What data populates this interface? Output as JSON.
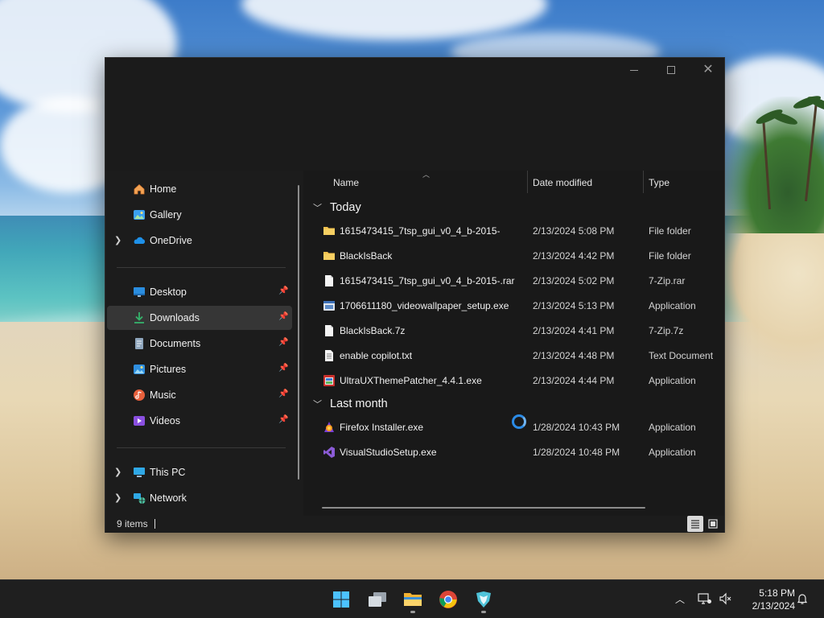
{
  "window": {
    "controls": {
      "minimize": "minimize",
      "maximize": "maximize",
      "close": "close"
    }
  },
  "nav": {
    "items": [
      {
        "label": "Home",
        "icon": "home-icon",
        "expandable": false,
        "pinned": false
      },
      {
        "label": "Gallery",
        "icon": "gallery-icon",
        "expandable": false,
        "pinned": false
      },
      {
        "label": "OneDrive",
        "icon": "onedrive-cloud-icon",
        "expandable": true,
        "pinned": false
      },
      {
        "label": "Desktop",
        "icon": "desktop-icon",
        "expandable": false,
        "pinned": true
      },
      {
        "label": "Downloads",
        "icon": "download-arrow-icon",
        "expandable": false,
        "pinned": true,
        "selected": true
      },
      {
        "label": "Documents",
        "icon": "document-icon",
        "expandable": false,
        "pinned": true
      },
      {
        "label": "Pictures",
        "icon": "pictures-icon",
        "expandable": false,
        "pinned": true
      },
      {
        "label": "Music",
        "icon": "music-icon",
        "expandable": false,
        "pinned": true
      },
      {
        "label": "Videos",
        "icon": "videos-icon",
        "expandable": false,
        "pinned": true
      },
      {
        "label": "This PC",
        "icon": "this-pc-icon",
        "expandable": true,
        "pinned": false
      },
      {
        "label": "Network",
        "icon": "network-icon",
        "expandable": true,
        "pinned": false
      }
    ]
  },
  "columns": {
    "name": "Name",
    "date": "Date modified",
    "type": "Type"
  },
  "groups": [
    {
      "label": "Today",
      "files": [
        {
          "name": "1615473415_7tsp_gui_v0_4_b-2015-",
          "date": "2/13/2024 5:08 PM",
          "type": "File folder",
          "icon": "folder-icon"
        },
        {
          "name": "BlackIsBack",
          "date": "2/13/2024 4:42 PM",
          "type": "File folder",
          "icon": "folder-icon"
        },
        {
          "name": "1615473415_7tsp_gui_v0_4_b-2015-.rar",
          "date": "2/13/2024 5:02 PM",
          "type": "7-Zip.rar",
          "icon": "file-icon"
        },
        {
          "name": "1706611180_videowallpaper_setup.exe",
          "date": "2/13/2024 5:13 PM",
          "type": "Application",
          "icon": "installer-icon"
        },
        {
          "name": "BlackIsBack.7z",
          "date": "2/13/2024 4:41 PM",
          "type": "7-Zip.7z",
          "icon": "file-icon"
        },
        {
          "name": "enable copilot.txt",
          "date": "2/13/2024 4:48 PM",
          "type": "Text Document",
          "icon": "text-file-icon"
        },
        {
          "name": "UltraUXThemePatcher_4.4.1.exe",
          "date": "2/13/2024 4:44 PM",
          "type": "Application",
          "icon": "patcher-app-icon"
        }
      ]
    },
    {
      "label": "Last month",
      "files": [
        {
          "name": "Firefox Installer.exe",
          "date": "1/28/2024 10:43 PM",
          "type": "Application",
          "icon": "firefox-icon"
        },
        {
          "name": "VisualStudioSetup.exe",
          "date": "1/28/2024 10:48 PM",
          "type": "Application",
          "icon": "visual-studio-icon"
        }
      ]
    }
  ],
  "status": {
    "count": "9 items"
  },
  "taskbar": {
    "apps": [
      "start-icon",
      "task-view-icon",
      "file-explorer-icon",
      "chrome-icon",
      "app-icon"
    ],
    "time": "5:18 PM",
    "date": "2/13/2024"
  },
  "colors": {
    "accent": "#2b8be6",
    "window_bg": "#1c1c1c",
    "folder": "#f2c14e"
  }
}
